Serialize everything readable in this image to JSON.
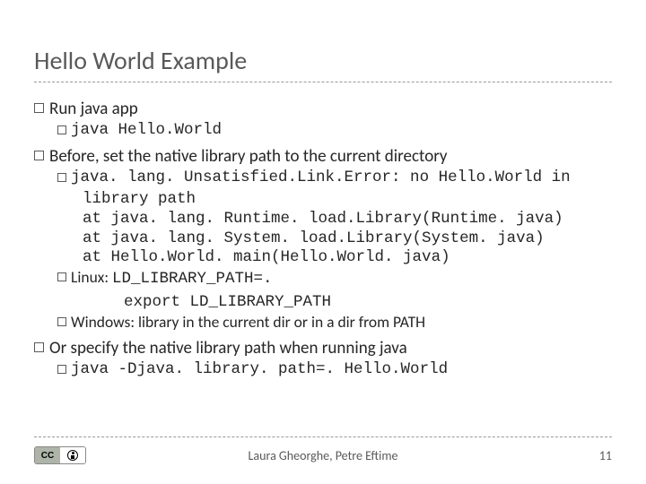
{
  "title": "Hello World Example",
  "item1": {
    "prefix": "Run",
    "rest": " java app",
    "sub1": "java Hello.World"
  },
  "item2": {
    "prefix": "Before",
    "rest": ", set the native library path to the current directory",
    "error1": "java. lang. Unsatisfied.Link.Error: no Hello.World in",
    "error2": "library path",
    "error3": "at java. lang. Runtime. load.Library(Runtime. java)",
    "error4": "at java. lang. System. load.Library(System. java)",
    "error5": "at Hello.World. main(Hello.World. java)",
    "linuxLabel": "Linux: ",
    "linux1": "LD_LIBRARY_PATH=.",
    "linux2": "export LD_LIBRARY_PATH",
    "winLabel": "Windows: ",
    "winText": "library in the current dir or in a dir from PATH"
  },
  "item3": {
    "prefix": "Or",
    "rest": " specify the native library path when running java",
    "sub1": "java -Djava. library. path=. Hello.World"
  },
  "footer": {
    "cc": "CC",
    "by": "BY",
    "authors": "Laura Gheorghe, Petre Eftime",
    "page": "11"
  }
}
